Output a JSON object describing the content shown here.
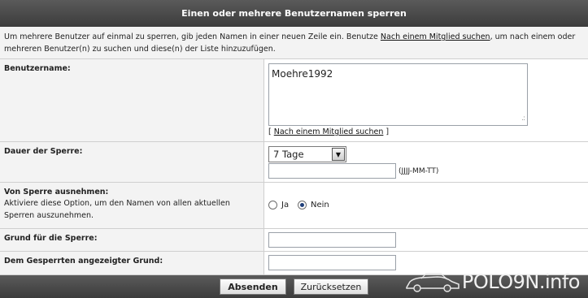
{
  "dialog": {
    "title": "Einen oder mehrere Benutzernamen sperren"
  },
  "intro": {
    "text_before": "Um mehrere Benutzer auf einmal zu sperren, gib jeden Namen in einer neuen Zeile ein. Benutze ",
    "link": "Nach einem Mitglied suchen",
    "text_after": ", um nach einem oder mehreren Benutzer(n) zu suchen und diese(n) der Liste hinzuzufügen."
  },
  "username": {
    "label": "Benutzername:",
    "value": "Moehre1992",
    "find_prefix": "[ ",
    "find_link": "Nach einem Mitglied suchen",
    "find_suffix": " ]"
  },
  "duration": {
    "label": "Dauer der Sperre:",
    "selected": "7 Tage",
    "date_value": "",
    "date_format": "(JJJJ-MM-TT)"
  },
  "exclude": {
    "label": "Von Sperre ausnehmen:",
    "description": "Aktiviere diese Option, um den Namen von allen aktuellen Sperren auszunehmen.",
    "options": [
      "Ja",
      "Nein"
    ],
    "selected": "Nein"
  },
  "reason": {
    "label": "Grund für die Sperre:",
    "value": ""
  },
  "shown_reason": {
    "label": "Dem Gesperrten angezeigter Grund:",
    "value": ""
  },
  "buttons": {
    "submit": "Absenden",
    "reset": "Zurücksetzen"
  },
  "brand": {
    "text": "POLO9N.info"
  }
}
